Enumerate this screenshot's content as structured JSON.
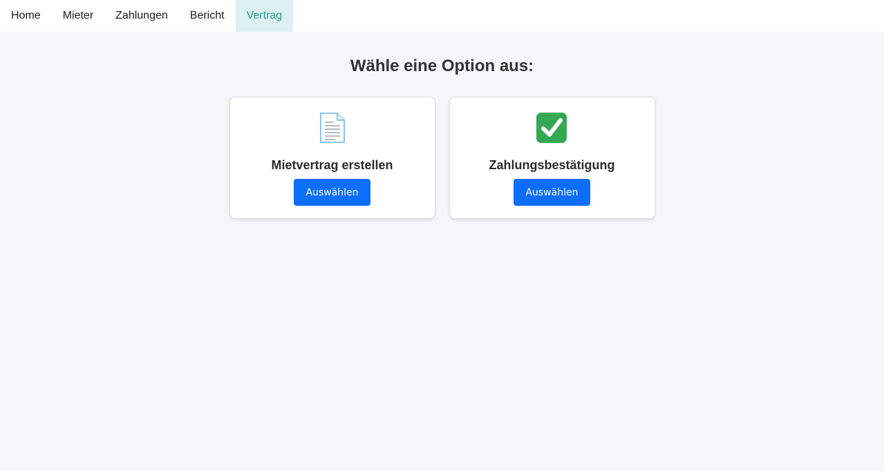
{
  "nav": {
    "items": [
      {
        "label": "Home"
      },
      {
        "label": "Mieter"
      },
      {
        "label": "Zahlungen"
      },
      {
        "label": "Bericht"
      },
      {
        "label": "Vertrag",
        "active": true
      }
    ]
  },
  "main": {
    "title": "Wähle eine Option aus:",
    "cards": [
      {
        "icon": "document-icon",
        "title": "Mietvertrag erstellen",
        "button_label": "Auswählen"
      },
      {
        "icon": "check-mark-icon",
        "title": "Zahlungsbestätigung",
        "button_label": "Auswählen"
      }
    ]
  },
  "colors": {
    "accent": "#0d6efd",
    "nav_active_bg": "#dcf0f2",
    "nav_active_text": "#2a9d8f",
    "page_bg": "#f4f6fa",
    "check_green": "#34a853"
  }
}
